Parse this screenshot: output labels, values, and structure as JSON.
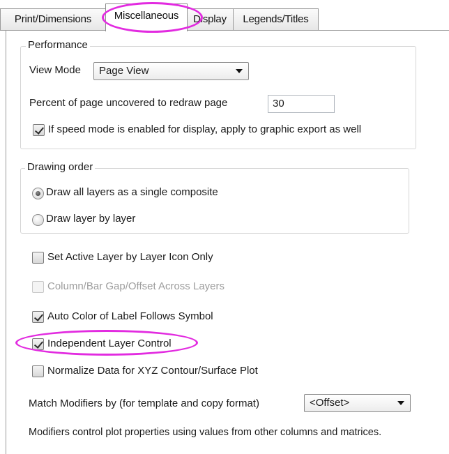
{
  "tabs": [
    {
      "label": "Print/Dimensions",
      "active": false
    },
    {
      "label": "Miscellaneous",
      "active": true
    },
    {
      "label": "Display",
      "active": false
    },
    {
      "label": "Legends/Titles",
      "active": false
    }
  ],
  "performance": {
    "group_title": "Performance",
    "view_mode_label": "View Mode",
    "view_mode_value": "Page View",
    "redraw_label": "Percent of page uncovered to redraw page",
    "redraw_value": "30",
    "speed_mode_label": "If speed mode is enabled for display, apply to graphic export as well",
    "speed_mode_checked": true
  },
  "drawing_order": {
    "group_title": "Drawing order",
    "options": [
      {
        "label": "Draw all layers as a single composite",
        "selected": true
      },
      {
        "label": "Draw layer by layer",
        "selected": false
      }
    ]
  },
  "options": [
    {
      "label": "Set Active Layer by Layer Icon Only",
      "checked": false,
      "disabled": false
    },
    {
      "label": "Column/Bar Gap/Offset Across Layers",
      "checked": false,
      "disabled": true
    },
    {
      "label": "Auto Color of Label Follows Symbol",
      "checked": true,
      "disabled": false
    },
    {
      "label": "Independent Layer Control",
      "checked": true,
      "disabled": false
    },
    {
      "label": "Normalize Data for XYZ Contour/Surface Plot",
      "checked": false,
      "disabled": false
    }
  ],
  "match_modifiers": {
    "label": "Match Modifiers by (for template and copy format)",
    "value": "<Offset>"
  },
  "footer_note": "Modifiers control plot properties using values from other columns and matrices.",
  "colors": {
    "highlight": "#e22be0",
    "border": "#9a9a9a"
  }
}
